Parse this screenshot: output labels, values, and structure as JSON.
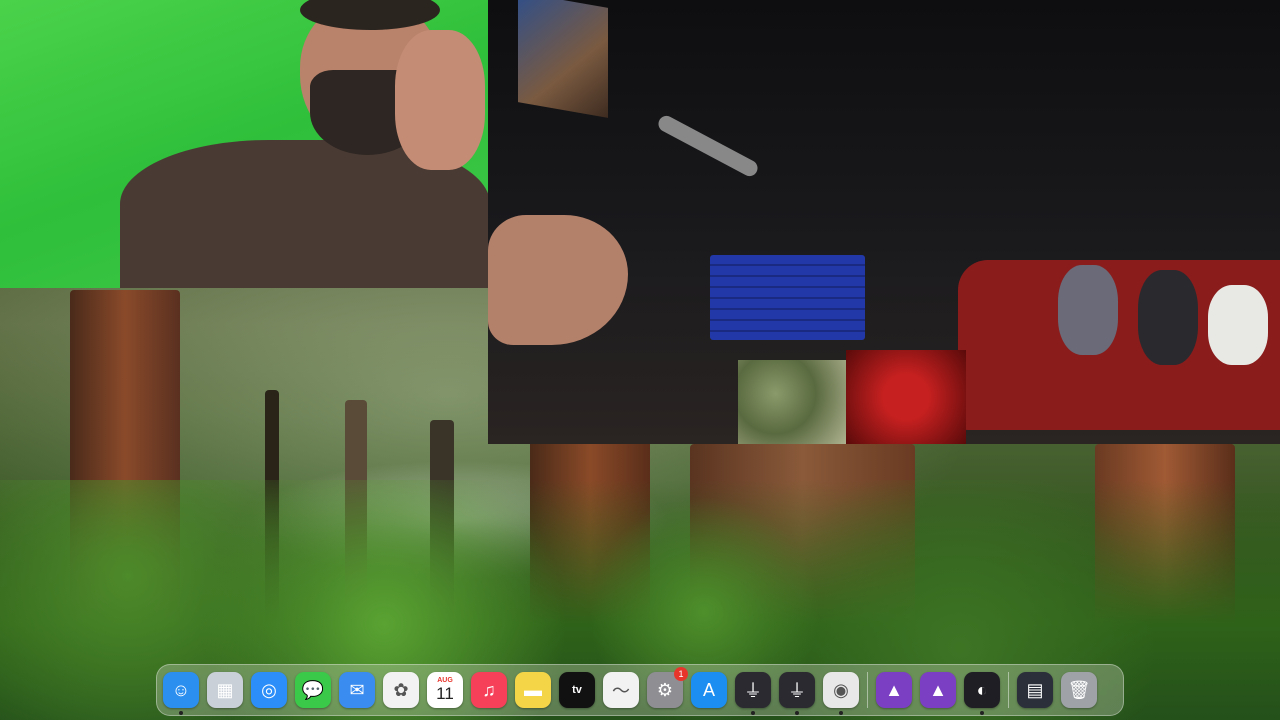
{
  "dock": {
    "items": [
      {
        "name": "finder",
        "glyph": "☺",
        "color": "#2b8ff0",
        "running": true
      },
      {
        "name": "launchpad",
        "glyph": "▦",
        "color": "#c9d0d8",
        "running": false
      },
      {
        "name": "safari",
        "glyph": "◎",
        "color": "#2c8ef8",
        "running": false
      },
      {
        "name": "messages",
        "glyph": "💬",
        "color": "#3bc94a",
        "running": false
      },
      {
        "name": "mail",
        "glyph": "✉",
        "color": "#3a8cf0",
        "running": false
      },
      {
        "name": "photos",
        "glyph": "✿",
        "color": "#f2f2f2",
        "running": false
      },
      {
        "name": "calendar",
        "month": "AUG",
        "day": "11",
        "running": false
      },
      {
        "name": "music",
        "glyph": "♫",
        "color": "#f6405a",
        "running": false
      },
      {
        "name": "notes",
        "glyph": "▬",
        "color": "#f5d548",
        "running": false
      },
      {
        "name": "apple-tv",
        "label": "tv",
        "running": false
      },
      {
        "name": "freeform",
        "glyph": "〜",
        "color": "#f2f2f2",
        "running": false
      },
      {
        "name": "system-settings",
        "glyph": "⚙",
        "color": "#8e8e93",
        "badge": "1",
        "running": false
      },
      {
        "name": "app-store",
        "glyph": "A",
        "color": "#1c8ef2",
        "running": false
      },
      {
        "name": "audio-mixer-1",
        "glyph": "⏚",
        "color": "#2a2a30",
        "running": true
      },
      {
        "name": "audio-mixer-2",
        "glyph": "⏚",
        "color": "#2a2a30",
        "running": true
      },
      {
        "name": "chrome",
        "glyph": "◉",
        "color": "#e8e8e8",
        "running": true
      },
      {
        "name": "obs-purple-1",
        "glyph": "▲",
        "color": "#7b3fc4",
        "running": false
      },
      {
        "name": "obs-purple-2",
        "glyph": "▲",
        "color": "#7b3fc4",
        "running": false
      },
      {
        "name": "obs",
        "glyph": "◐",
        "color": "#1e1e24",
        "running": true
      },
      {
        "name": "screen-recorder",
        "glyph": "▤",
        "color": "#2a2f3a",
        "running": false
      },
      {
        "name": "trash",
        "glyph": "🗑",
        "color": "#9fa3a8",
        "running": false
      }
    ]
  }
}
